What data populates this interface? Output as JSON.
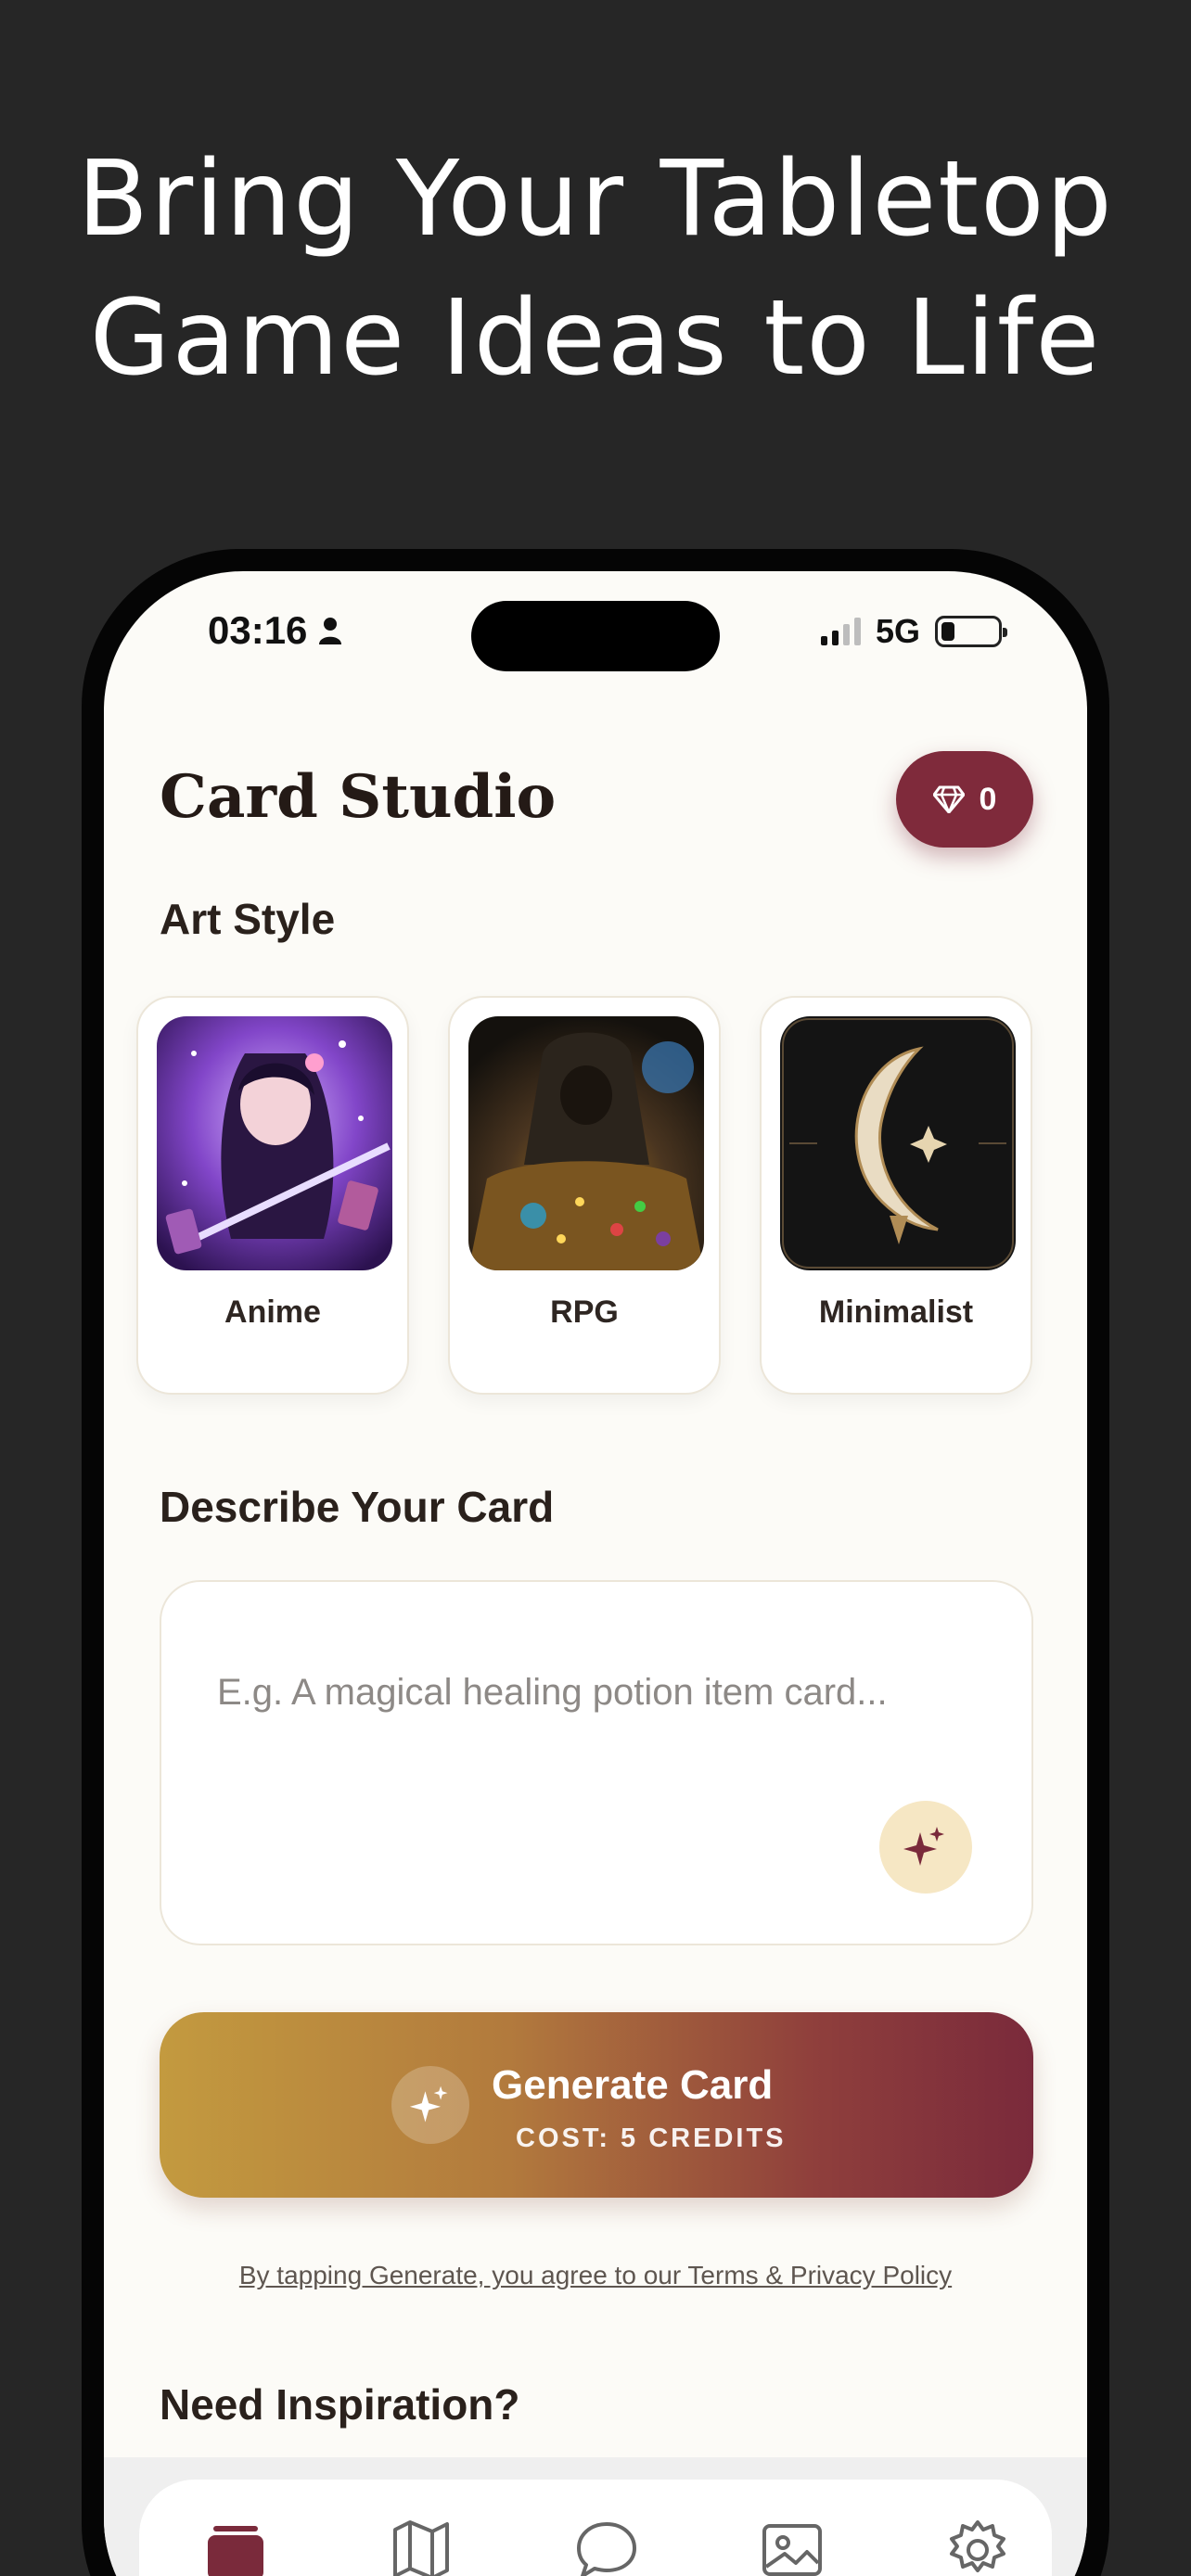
{
  "headline": {
    "line1": "Bring Your Tabletop",
    "line2": "Game Ideas to Life"
  },
  "status_bar": {
    "time": "03:16",
    "network": "5G"
  },
  "header": {
    "title": "Card Studio",
    "credits_count": "0"
  },
  "art_style": {
    "section_title": "Art Style",
    "options": [
      {
        "label": "Anime"
      },
      {
        "label": "RPG"
      },
      {
        "label": "Minimalist"
      }
    ]
  },
  "describe": {
    "section_title": "Describe Your Card",
    "placeholder": "E.g. A magical healing potion item card..."
  },
  "generate": {
    "label": "Generate Card",
    "cost": "COST: 5 CREDITS"
  },
  "legal": {
    "text": "By tapping Generate, you agree to our Terms & Privacy Policy"
  },
  "inspiration": {
    "section_title": "Need Inspiration?"
  },
  "tabs": [
    {
      "icon": "cards-icon",
      "active": true
    },
    {
      "icon": "map-icon",
      "active": false
    },
    {
      "icon": "chat-icon",
      "active": false
    },
    {
      "icon": "gallery-icon",
      "active": false
    },
    {
      "icon": "settings-icon",
      "active": false
    }
  ],
  "colors": {
    "background": "#262626",
    "accent": "#7f2a3b",
    "gold": "#c39a3f",
    "screen": "#fcfbf7"
  }
}
